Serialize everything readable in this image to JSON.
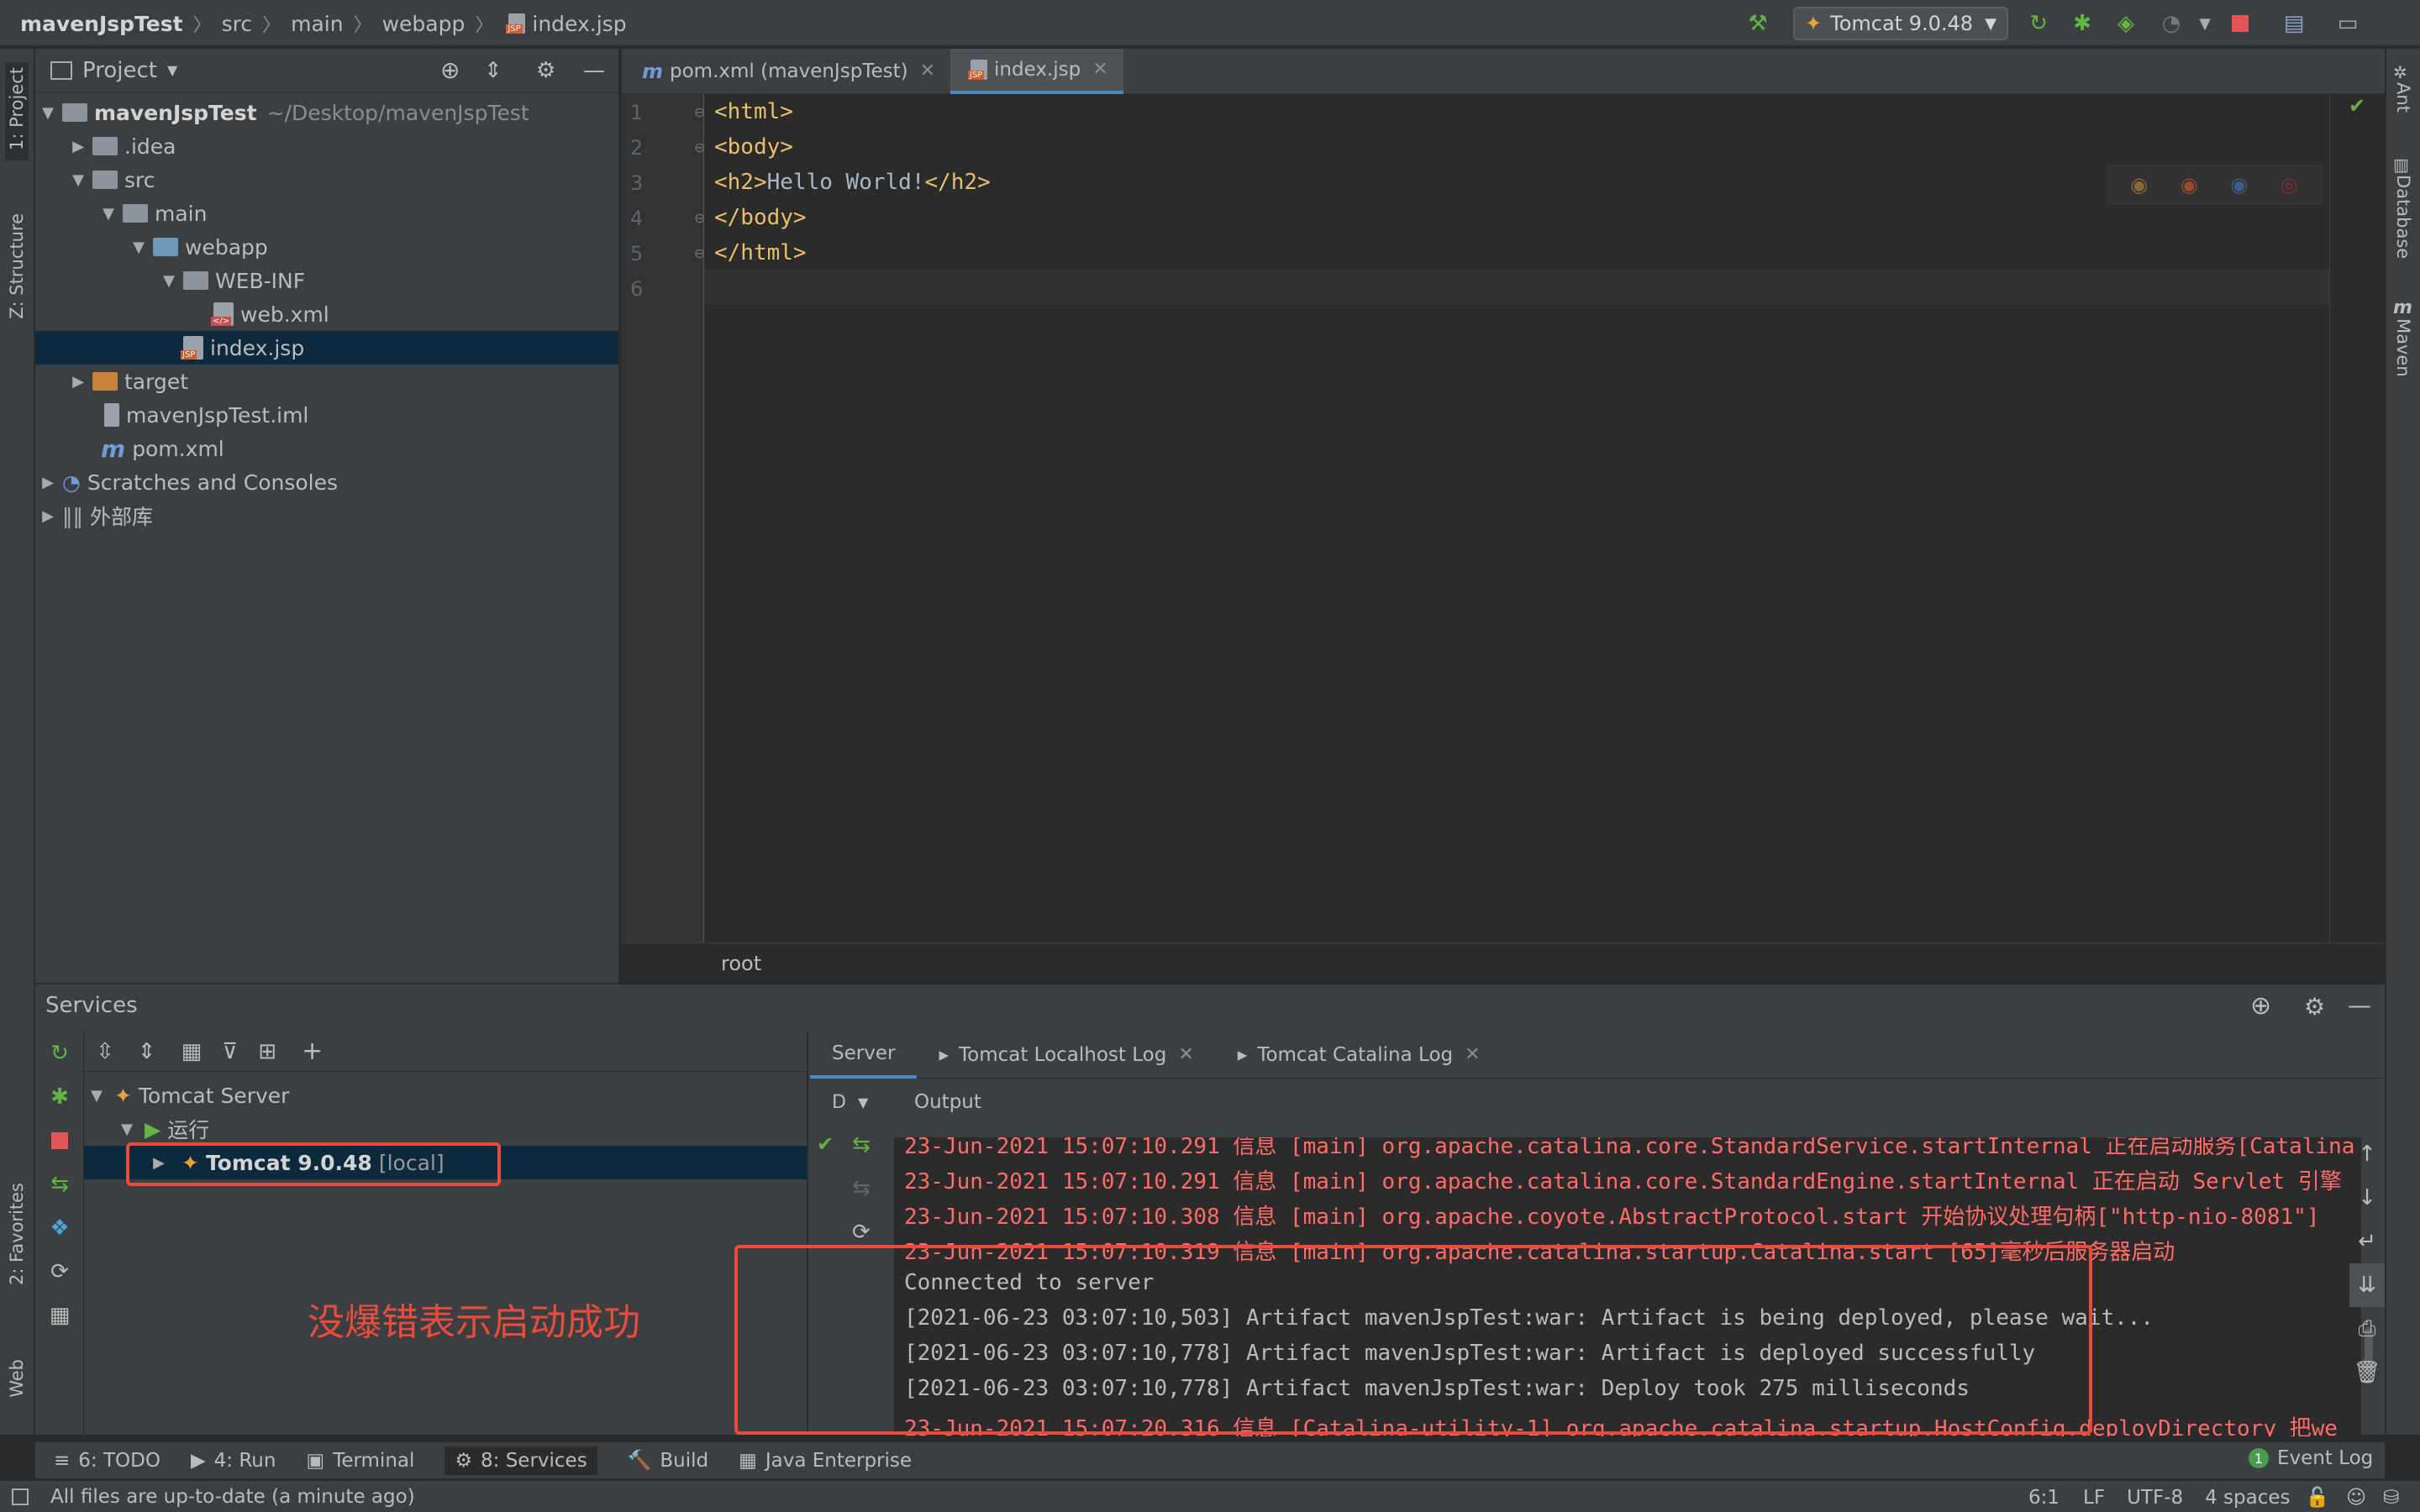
{
  "breadcrumb": [
    "mavenJspTest",
    "src",
    "main",
    "webapp",
    "index.jsp"
  ],
  "run_config": "Tomcat 9.0.48",
  "left_stripe": [
    "1: Project",
    "Z: Structure",
    "2: Favorites",
    "Web"
  ],
  "right_stripe": [
    "Ant",
    "Database",
    "Maven"
  ],
  "project": {
    "title": "Project",
    "tree": [
      {
        "label": "mavenJspTest",
        "extra": "~/Desktop/mavenJspTest"
      },
      {
        "label": ".idea"
      },
      {
        "label": "src"
      },
      {
        "label": "main"
      },
      {
        "label": "webapp"
      },
      {
        "label": "WEB-INF"
      },
      {
        "label": "web.xml"
      },
      {
        "label": "index.jsp"
      },
      {
        "label": "target"
      },
      {
        "label": "mavenJspTest.iml"
      },
      {
        "label": "pom.xml"
      },
      {
        "label": "Scratches and Consoles"
      },
      {
        "label": "外部库"
      }
    ]
  },
  "editor": {
    "tabs": [
      "pom.xml (mavenJspTest)",
      "index.jsp"
    ],
    "lines": [
      {
        "num": "1",
        "parts": [
          {
            "t": "tag",
            "v": "<html>"
          }
        ]
      },
      {
        "num": "2",
        "parts": [
          {
            "t": "tag",
            "v": "<body>"
          }
        ]
      },
      {
        "num": "3",
        "parts": [
          {
            "t": "tag",
            "v": "<h2>"
          },
          {
            "t": "txt",
            "v": "Hello World!"
          },
          {
            "t": "tag",
            "v": "</h2>"
          }
        ]
      },
      {
        "num": "4",
        "parts": [
          {
            "t": "tag",
            "v": "</body>"
          }
        ]
      },
      {
        "num": "5",
        "parts": [
          {
            "t": "tag",
            "v": "</html>"
          }
        ]
      },
      {
        "num": "6",
        "parts": []
      }
    ],
    "footer_crumb": "root"
  },
  "services": {
    "title": "Services",
    "tree": {
      "server": "Tomcat Server",
      "running": "运行",
      "instance": "Tomcat 9.0.48",
      "instance_suffix": "[local]"
    },
    "tabs": [
      "Server",
      "Tomcat Localhost Log",
      "Tomcat Catalina Log"
    ],
    "col_d": "D",
    "output_label": "Output",
    "console": [
      {
        "c": "red",
        "v": "23-Jun-2021 15:07:10.291 信息 [main] org.apache.catalina.core.StandardService.startInternal 正在启动服务[Catalina"
      },
      {
        "c": "red",
        "v": "23-Jun-2021 15:07:10.291 信息 [main] org.apache.catalina.core.StandardEngine.startInternal 正在启动 Servlet 引擎"
      },
      {
        "c": "red",
        "v": "23-Jun-2021 15:07:10.308 信息 [main] org.apache.coyote.AbstractProtocol.start 开始协议处理句柄[\"http-nio-8081\"]"
      },
      {
        "c": "red",
        "v": "23-Jun-2021 15:07:10.319 信息 [main] org.apache.catalina.startup.Catalina.start [65]毫秒后服务器启动"
      },
      {
        "c": "gray",
        "v": "Connected to server"
      },
      {
        "c": "gray",
        "v": "[2021-06-23 03:07:10,503] Artifact mavenJspTest:war: Artifact is being deployed, please wait..."
      },
      {
        "c": "gray",
        "v": "[2021-06-23 03:07:10,778] Artifact mavenJspTest:war: Artifact is deployed successfully"
      },
      {
        "c": "gray",
        "v": "[2021-06-23 03:07:10,778] Artifact mavenJspTest:war: Deploy took 275 milliseconds"
      },
      {
        "c": "red",
        "v": "23-Jun-2021 15:07:20.316 信息 [Catalina-utility-1] org.apache.catalina.startup.HostConfig.deployDirectory 把we"
      }
    ]
  },
  "annotation": "没爆错表示启动成功",
  "bottom_tools": [
    {
      "icon": "≡",
      "label": "6: TODO"
    },
    {
      "icon": "▶",
      "label": "4: Run"
    },
    {
      "icon": "▣",
      "label": "Terminal"
    },
    {
      "icon": "⚙",
      "label": "8: Services"
    },
    {
      "icon": "🔨",
      "label": "Build"
    },
    {
      "icon": "▦",
      "label": "Java Enterprise"
    }
  ],
  "event_log": "Event Log",
  "event_count": "1",
  "status": {
    "message": "All files are up-to-date (a minute ago)",
    "position": "6:1",
    "line_sep": "LF",
    "encoding": "UTF-8",
    "indent": "4 spaces"
  },
  "colors": {
    "accent": "#4a88c7",
    "error": "#ff6b68",
    "annotation": "#e74c3c",
    "tag": "#e8bf6a"
  }
}
